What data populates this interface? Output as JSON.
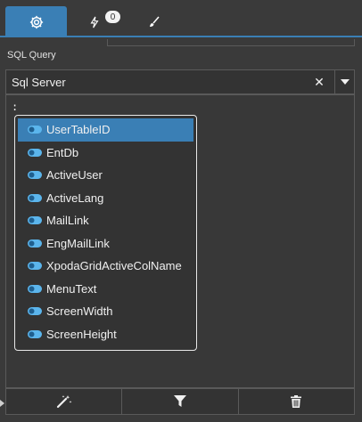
{
  "tabs": [
    {
      "icon": "gear-icon",
      "active": true
    },
    {
      "icon": "lightning-icon",
      "badge": "0"
    },
    {
      "icon": "brush-icon"
    }
  ],
  "section": {
    "label": "SQL Query"
  },
  "db_select": {
    "value": "Sql Server",
    "clear_glyph": "✕"
  },
  "editor": {
    "text": ":"
  },
  "autocomplete": {
    "items": [
      "UserTableID",
      "EntDb",
      "ActiveUser",
      "ActiveLang",
      "MailLink",
      "EngMailLink",
      "XpodaGridActiveColName",
      "MenuText",
      "ScreenWidth",
      "ScreenHeight"
    ],
    "selected_index": 0
  },
  "toolbar": {
    "tools": [
      "magic-wand-icon",
      "filter-icon",
      "trash-icon"
    ]
  },
  "colors": {
    "accent": "#3a7fb5",
    "background": "#3a3a3a"
  }
}
